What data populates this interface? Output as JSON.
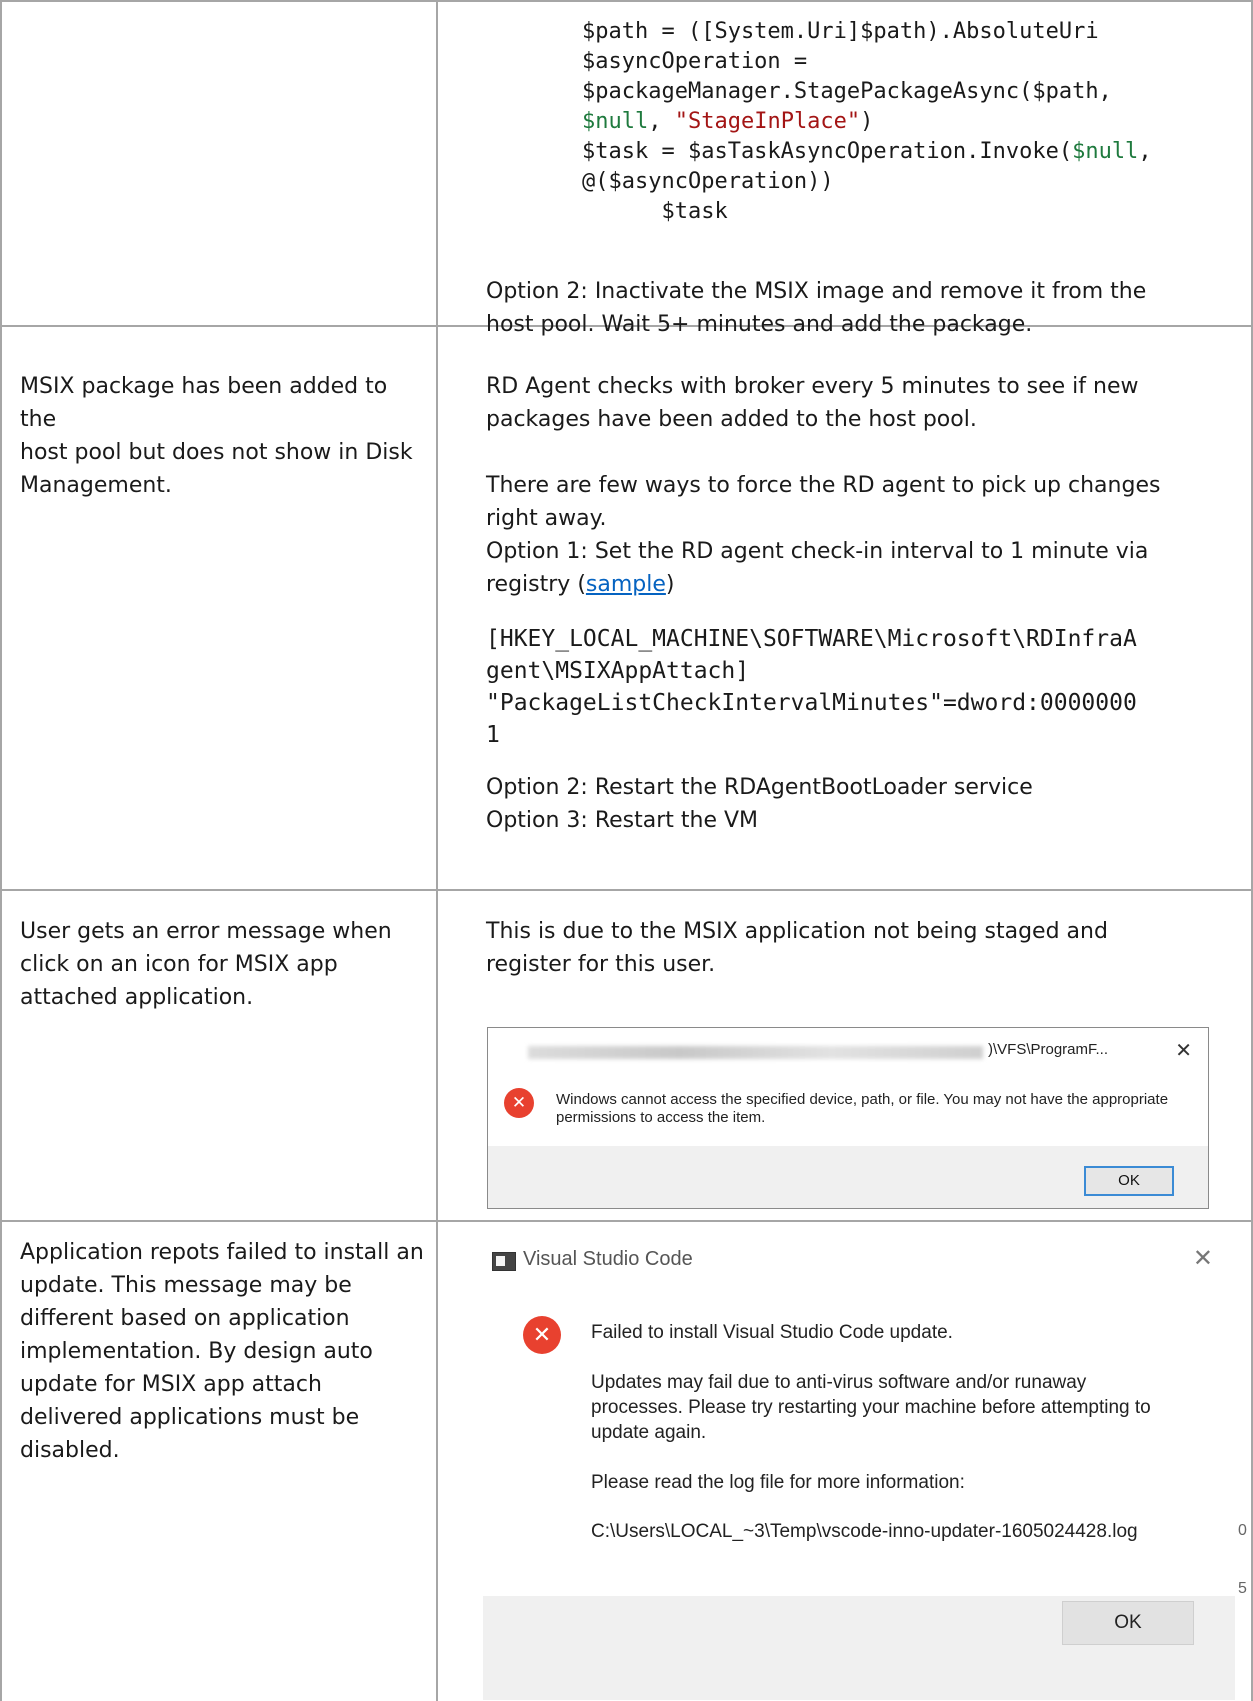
{
  "row1": {
    "code_lines": [
      {
        "parts": [
          {
            "t": "$path = ([System.Uri]$path).AbsoluteUri",
            "c": ""
          }
        ]
      },
      {
        "parts": [
          {
            "t": "$asyncOperation =",
            "c": ""
          }
        ]
      },
      {
        "parts": [
          {
            "t": "$packageManager.StagePackageAsync($path,",
            "c": ""
          }
        ]
      },
      {
        "parts": [
          {
            "t": "$null",
            "c": "grn"
          },
          {
            "t": ", ",
            "c": ""
          },
          {
            "t": "\"StageInPlace\"",
            "c": "str"
          },
          {
            "t": ")",
            "c": ""
          }
        ]
      },
      {
        "parts": [
          {
            "t": "$task = $asTaskAsyncOperation.Invoke(",
            "c": ""
          },
          {
            "t": "$null",
            "c": "grn"
          },
          {
            "t": ",",
            "c": ""
          }
        ]
      },
      {
        "parts": [
          {
            "t": "@($asyncOperation))",
            "c": ""
          }
        ]
      },
      {
        "parts": [
          {
            "t": "      $task",
            "c": ""
          }
        ]
      }
    ],
    "option2_line1": "Option 2: Inactivate the MSIX image and remove it from the",
    "option2_line2": "host pool. Wait 5+ minutes and add the package."
  },
  "row2": {
    "issue_lines": [
      "MSIX package has been added to the",
      "host pool but does not show in Disk",
      "Management."
    ],
    "lines_a": [
      "RD Agent checks with broker every 5 minutes to see if new",
      "packages have been added to the host pool."
    ],
    "lines_b": [
      "There are few ways to force the RD agent to pick up changes",
      "right away.",
      "Option 1: Set the RD agent check-in interval to 1 minute via"
    ],
    "registry_prefix": "registry (",
    "link_text": "sample",
    "registry_suffix": ")",
    "reg_lines": [
      "[HKEY_LOCAL_MACHINE\\SOFTWARE\\Microsoft\\RDInfraA",
      "gent\\MSIXAppAttach]",
      "\"PackageListCheckIntervalMinutes\"=dword:0000000",
      "1"
    ],
    "lines_c": [
      "Option 2: Restart the RDAgentBootLoader service",
      "Option 3: Restart the VM"
    ]
  },
  "row3": {
    "issue_lines": [
      "User gets an error message when",
      "click on an icon for MSIX app",
      "attached application."
    ],
    "resolution_lines": [
      "This is due to the MSIX application not being staged and",
      "register for this user."
    ],
    "dialog": {
      "path_visible": ")\\VFS\\ProgramF...",
      "close_glyph": "✕",
      "message_line1": "Windows cannot access the specified device, path, or file. You may not have the appropriate",
      "message_line2": "permissions to access the item.",
      "ok_label": "OK",
      "error_glyph": "✕"
    }
  },
  "row4": {
    "issue_lines": [
      "Application repots failed to install an",
      "update. This message may be",
      "different based on application",
      "implementation. By design auto",
      "update for MSIX app attach",
      "delivered applications must be",
      "disabled."
    ],
    "dialog": {
      "title": "Visual Studio Code",
      "close_glyph": "✕",
      "error_glyph": "✕",
      "heading": "Failed to install Visual Studio Code update.",
      "body_lines": [
        "Updates may fail due to anti-virus software and/or runaway",
        "processes. Please try restarting your machine before attempting to",
        "update again."
      ],
      "log_prompt": "Please read the log file for more information:",
      "log_path": "C:\\Users\\LOCAL_~3\\Temp\\vscode-inno-updater-1605024428.log",
      "ok_label": "OK",
      "edge_chars": [
        "0",
        "5"
      ]
    }
  }
}
